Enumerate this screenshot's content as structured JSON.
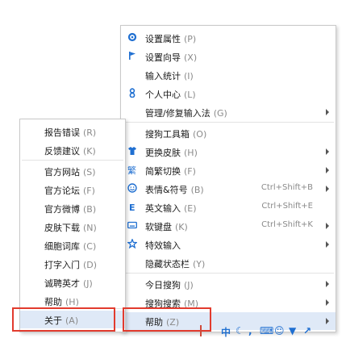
{
  "main_menu": {
    "items": [
      {
        "label": "设置属性",
        "accel": "(P)",
        "icon": "gear-icon"
      },
      {
        "label": "设置向导",
        "accel": "(X)",
        "icon": "flag-icon"
      },
      {
        "label": "输入统计",
        "accel": "(I)",
        "icon": ""
      },
      {
        "label": "个人中心",
        "accel": "(L)",
        "icon": "user-icon"
      },
      {
        "label": "管理/修复输入法",
        "accel": "(G)",
        "icon": "",
        "submenu": true
      },
      {
        "label": "搜狗工具箱",
        "accel": "(O)",
        "icon": ""
      },
      {
        "label": "更换皮肤",
        "accel": "(H)",
        "icon": "shirt-icon",
        "submenu": true
      },
      {
        "label": "简繁切换",
        "accel": "(F)",
        "icon": "traditional-chinese-icon",
        "submenu": true
      },
      {
        "label": "表情&符号",
        "accel": "(B)",
        "icon": "smiley-icon",
        "shortcut": "Ctrl+Shift+B",
        "submenu": true
      },
      {
        "label": "英文输入",
        "accel": "(E)",
        "icon": "english-icon",
        "shortcut": "Ctrl+Shift+E"
      },
      {
        "label": "软键盘",
        "accel": "(K)",
        "icon": "keyboard-icon",
        "shortcut": "Ctrl+Shift+K",
        "submenu": true
      },
      {
        "label": "特效输入",
        "accel": "",
        "icon": "effects-icon",
        "submenu": true
      },
      {
        "label": "隐藏状态栏",
        "accel": "(Y)",
        "icon": ""
      },
      {
        "label": "今日搜狗",
        "accel": "(J)",
        "icon": "",
        "submenu": true
      },
      {
        "label": "搜狗搜索",
        "accel": "(M)",
        "icon": "",
        "submenu": true
      },
      {
        "label": "帮助",
        "accel": "(Z)",
        "icon": "",
        "submenu": true
      }
    ]
  },
  "help_menu": {
    "items": [
      {
        "label": "报告错误",
        "accel": "(R)"
      },
      {
        "label": "反馈建议",
        "accel": "(K)"
      },
      {
        "label": "官方网站",
        "accel": "(S)"
      },
      {
        "label": "官方论坛",
        "accel": "(F)"
      },
      {
        "label": "官方微博",
        "accel": "(B)"
      },
      {
        "label": "皮肤下载",
        "accel": "(N)"
      },
      {
        "label": "细胞词库",
        "accel": "(C)"
      },
      {
        "label": "打字入门",
        "accel": "(D)"
      },
      {
        "label": "诚聘英才",
        "accel": "(J)"
      },
      {
        "label": "帮助",
        "accel": "(H)"
      },
      {
        "label": "关于",
        "accel": "(A)"
      }
    ]
  },
  "toolbar": {
    "mode": "中"
  },
  "colors": {
    "highlight": "#dfe9f7",
    "accent": "#1f6fd1",
    "annotation": "#e23b2e"
  }
}
